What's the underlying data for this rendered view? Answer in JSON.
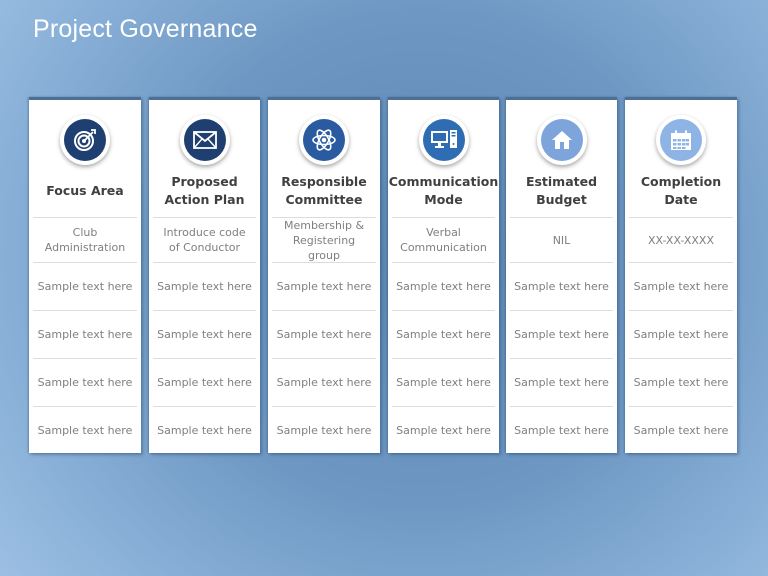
{
  "title": "Project Governance",
  "colors": {
    "navy": "#1f3f70",
    "blue": "#2e6db4",
    "light_blue": "#8eb0df"
  },
  "columns": [
    {
      "heading": "Focus Area",
      "icon": "target-icon",
      "icon_color": "#1f3f70",
      "value": "Club Administration",
      "rows": [
        "Sample text here",
        "Sample text here",
        "Sample text here",
        "Sample text here"
      ]
    },
    {
      "heading": "Proposed Action Plan",
      "icon": "envelope-icon",
      "icon_color": "#1f3f70",
      "value": "Introduce code of Conductor",
      "rows": [
        "Sample text here",
        "Sample text here",
        "Sample text here",
        "Sample text here"
      ]
    },
    {
      "heading": "Responsible Committee",
      "icon": "atom-icon",
      "icon_color": "#2a5aa0",
      "value": "Membership & Registering group",
      "rows": [
        "Sample text here",
        "Sample text here",
        "Sample text here",
        "Sample text here"
      ]
    },
    {
      "heading": "Communication Mode",
      "icon": "computer-icon",
      "icon_color": "#2e6db4",
      "value": "Verbal Communication",
      "rows": [
        "Sample text here",
        "Sample text here",
        "Sample text here",
        "Sample text here"
      ]
    },
    {
      "heading": "Estimated Budget",
      "icon": "home-icon",
      "icon_color": "#7ea4dc",
      "value": "NIL",
      "rows": [
        "Sample text here",
        "Sample text here",
        "Sample text here",
        "Sample text here"
      ]
    },
    {
      "heading": "Completion Date",
      "icon": "calendar-icon",
      "icon_color": "#8eb4e6",
      "value": "XX-XX-XXXX",
      "rows": [
        "Sample text here",
        "Sample text here",
        "Sample text here",
        "Sample text here"
      ]
    }
  ]
}
